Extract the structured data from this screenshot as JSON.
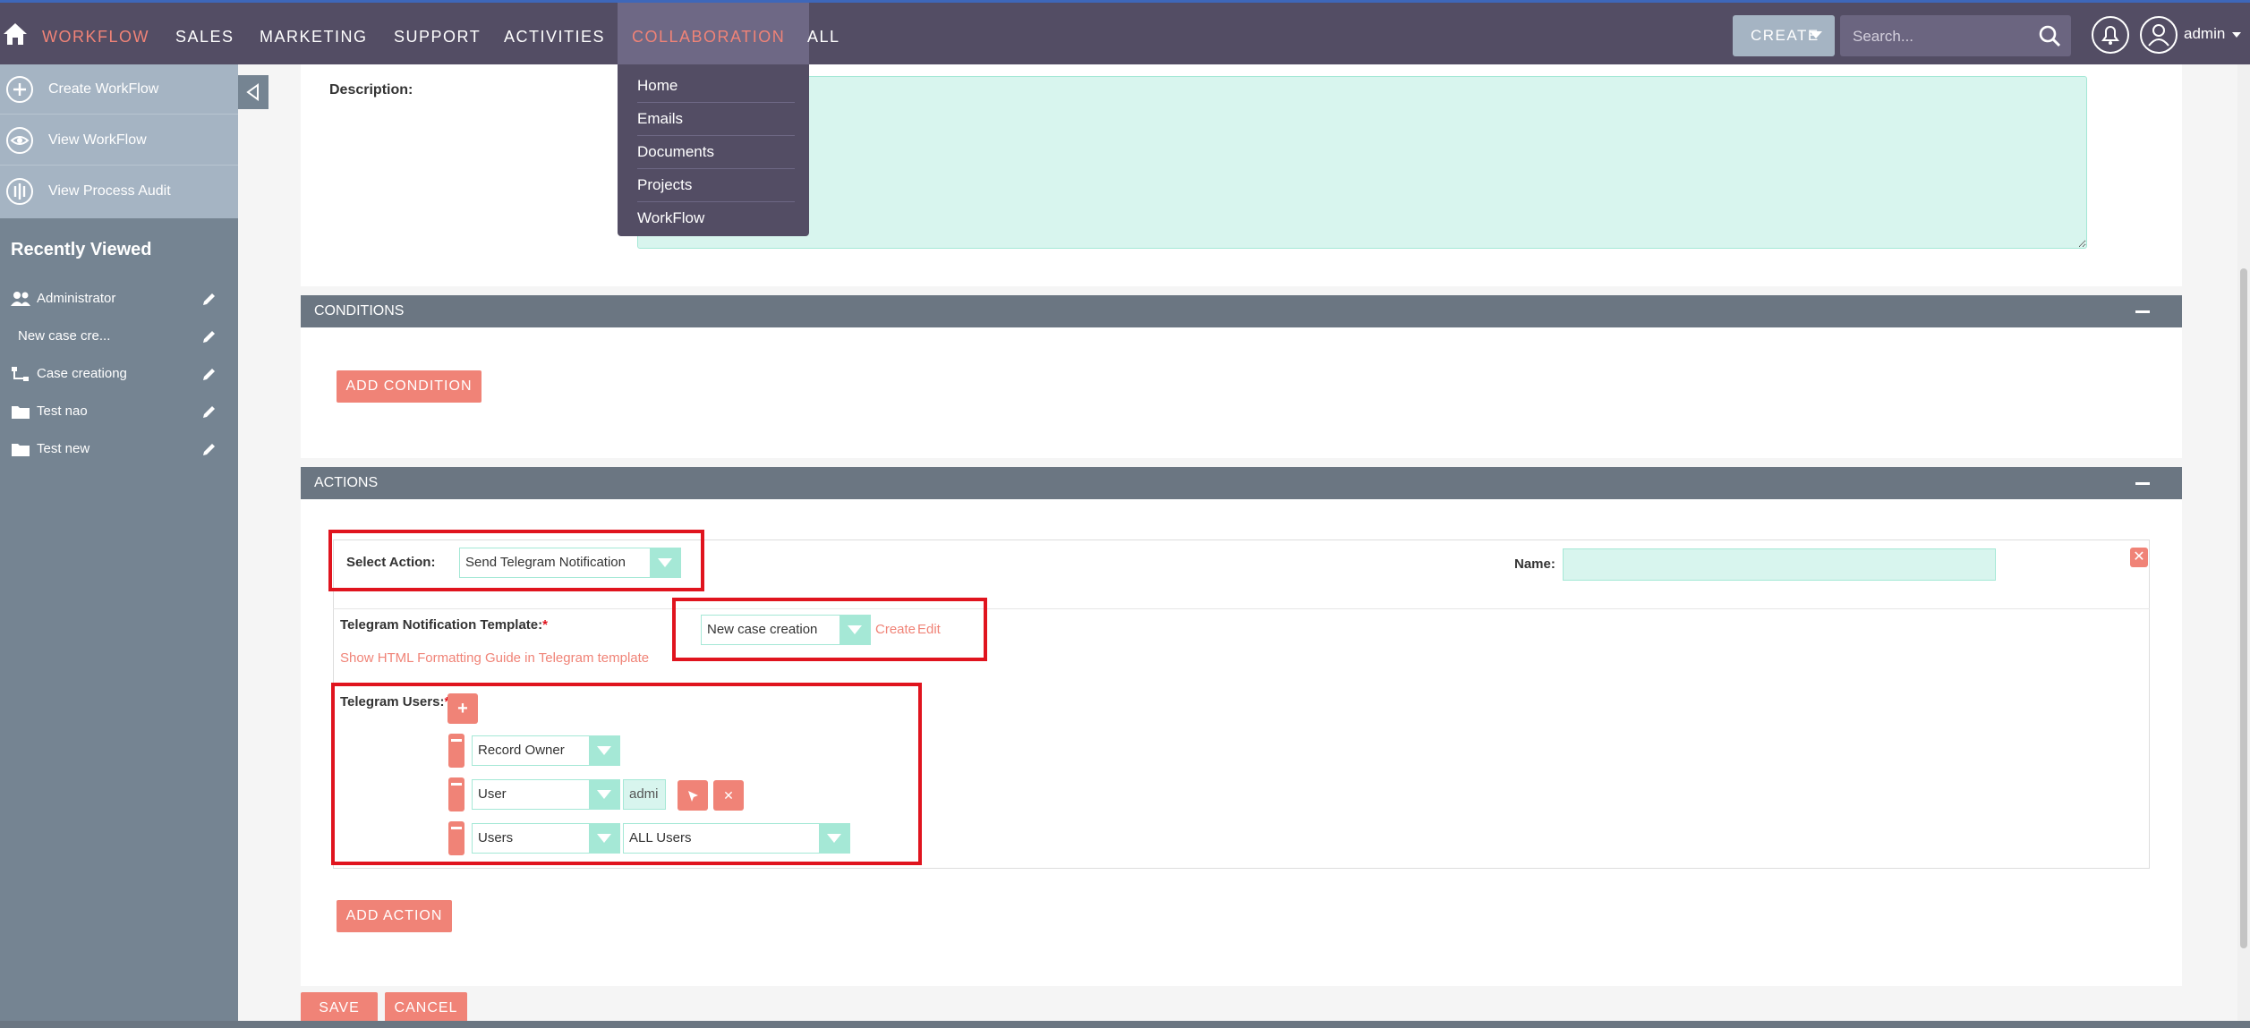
{
  "nav": {
    "items": [
      "WORKFLOW",
      "SALES",
      "MARKETING",
      "SUPPORT",
      "ACTIVITIES",
      "COLLABORATION",
      "ALL"
    ],
    "create_label": "CREATE",
    "search_placeholder": "Search...",
    "user_label": "admin",
    "active_color": "#f08377",
    "bar_color": "#534d64"
  },
  "dropdown": {
    "items": [
      "Home",
      "Emails",
      "Documents",
      "Projects",
      "WorkFlow"
    ]
  },
  "sidebar": {
    "actions": [
      "Create WorkFlow",
      "View WorkFlow",
      "View Process Audit"
    ],
    "recent_heading": "Recently Viewed",
    "recent": [
      {
        "label": "Administrator",
        "icon": "user-group-icon"
      },
      {
        "label": "New case cre...",
        "icon": ""
      },
      {
        "label": "Case creationg",
        "icon": "workflow-icon"
      },
      {
        "label": "Test nao",
        "icon": "folder-icon"
      },
      {
        "label": "Test new",
        "icon": "folder-icon"
      }
    ]
  },
  "form": {
    "description_label": "Description:",
    "conditions_header": "CONDITIONS",
    "add_condition": "ADD CONDITION",
    "actions_header": "ACTIONS",
    "select_action_label": "Select Action:",
    "select_action_value": "Send Telegram Notification",
    "name_label": "Name:",
    "template_label": "Telegram Notification Template:",
    "required_mark": "*",
    "template_value": "New case creation",
    "create_link": "Create",
    "edit_link": "Edit",
    "html_guide_link": "Show HTML Formatting Guide in Telegram template",
    "users_label": "Telegram Users:",
    "user_rows": [
      {
        "type": "Record Owner"
      },
      {
        "type": "User",
        "value": "admi"
      },
      {
        "type": "Users",
        "value": "ALL Users"
      }
    ],
    "add_action": "ADD ACTION",
    "save": "SAVE",
    "cancel": "CANCEL"
  }
}
